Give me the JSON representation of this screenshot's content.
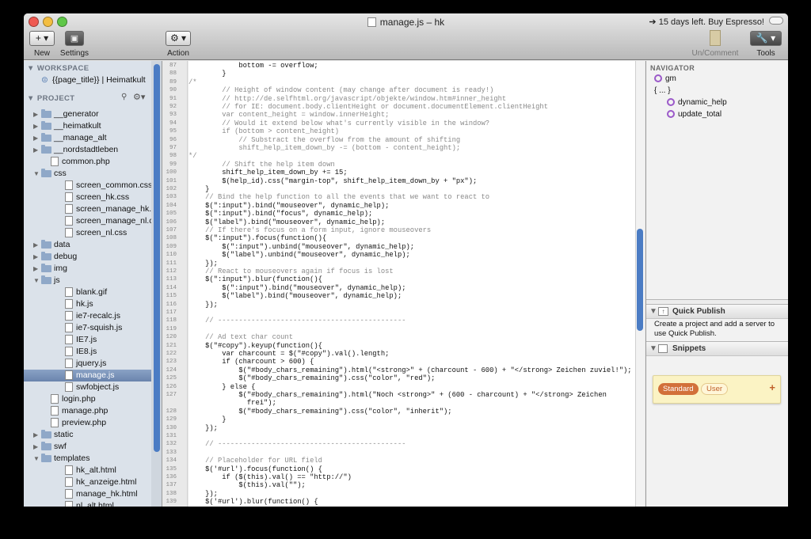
{
  "window": {
    "title": "manage.js – hk",
    "trial_notice": "15 days left. Buy Espresso!"
  },
  "toolbar": {
    "new_label": "New",
    "new_glyph": "+ ▾",
    "settings_label": "Settings",
    "action_label": "Action",
    "action_glyph": "⚙ ▾",
    "uncomment_label": "Un/Comment",
    "tools_label": "Tools",
    "tools_glyph": "🔧 ▾"
  },
  "sidebar": {
    "workspace_header": "WORKSPACE",
    "workspace_item": "{{page_title}} | Heimatkult",
    "project_header": "PROJECT",
    "tree": [
      {
        "label": "__generator",
        "type": "folder",
        "depth": 0,
        "open": false
      },
      {
        "label": "__heimatkult",
        "type": "folder",
        "depth": 0,
        "open": false
      },
      {
        "label": "__manage_alt",
        "type": "folder",
        "depth": 0,
        "open": false
      },
      {
        "label": "__nordstadtleben",
        "type": "folder",
        "depth": 0,
        "open": false
      },
      {
        "label": "common.php",
        "type": "file",
        "depth": 0
      },
      {
        "label": "css",
        "type": "folder",
        "depth": 0,
        "open": true
      },
      {
        "label": "screen_common.css",
        "type": "file",
        "depth": 1
      },
      {
        "label": "screen_hk.css",
        "type": "file",
        "depth": 1
      },
      {
        "label": "screen_manage_hk.css",
        "type": "file",
        "depth": 1
      },
      {
        "label": "screen_manage_nl.css",
        "type": "file",
        "depth": 1
      },
      {
        "label": "screen_nl.css",
        "type": "file",
        "depth": 1
      },
      {
        "label": "data",
        "type": "folder",
        "depth": 0,
        "open": false
      },
      {
        "label": "debug",
        "type": "folder",
        "depth": 0,
        "open": false
      },
      {
        "label": "img",
        "type": "folder",
        "depth": 0,
        "open": false
      },
      {
        "label": "js",
        "type": "folder",
        "depth": 0,
        "open": true
      },
      {
        "label": "blank.gif",
        "type": "file",
        "depth": 1
      },
      {
        "label": "hk.js",
        "type": "file",
        "depth": 1
      },
      {
        "label": "ie7-recalc.js",
        "type": "file",
        "depth": 1
      },
      {
        "label": "ie7-squish.js",
        "type": "file",
        "depth": 1
      },
      {
        "label": "IE7.js",
        "type": "file",
        "depth": 1
      },
      {
        "label": "IE8.js",
        "type": "file",
        "depth": 1
      },
      {
        "label": "jquery.js",
        "type": "file",
        "depth": 1
      },
      {
        "label": "manage.js",
        "type": "file",
        "depth": 1,
        "selected": true
      },
      {
        "label": "swfobject.js",
        "type": "file",
        "depth": 1
      },
      {
        "label": "login.php",
        "type": "file",
        "depth": 0
      },
      {
        "label": "manage.php",
        "type": "file",
        "depth": 0
      },
      {
        "label": "preview.php",
        "type": "file",
        "depth": 0
      },
      {
        "label": "static",
        "type": "folder",
        "depth": 0,
        "open": false
      },
      {
        "label": "swf",
        "type": "folder",
        "depth": 0,
        "open": false
      },
      {
        "label": "templates",
        "type": "folder",
        "depth": 0,
        "open": true
      },
      {
        "label": "hk_alt.html",
        "type": "file",
        "depth": 1
      },
      {
        "label": "hk_anzeige.html",
        "type": "file",
        "depth": 1
      },
      {
        "label": "manage_hk.html",
        "type": "file",
        "depth": 1
      },
      {
        "label": "nl_alt.html",
        "type": "file",
        "depth": 1
      }
    ]
  },
  "editor": {
    "lines": [
      {
        "n": "87",
        "t": "            bottom -= overflow;",
        "c": ""
      },
      {
        "n": "88",
        "t": "        }",
        "c": ""
      },
      {
        "n": "89",
        "t": "/*",
        "c": "cm"
      },
      {
        "n": "90",
        "t": "        // Height of window content (may change after document is ready!)",
        "c": "cm"
      },
      {
        "n": "91",
        "t": "        // http://de.selfhtml.org/javascript/objekte/window.htm#inner_height",
        "c": "cm"
      },
      {
        "n": "92",
        "t": "        // for IE: document.body.clientHeight or document.documentElement.clientHeight",
        "c": "cm"
      },
      {
        "n": "93",
        "t": "        var content_height = window.innerHeight;",
        "c": "cm"
      },
      {
        "n": "94",
        "t": "        // Would it extend below what's currently visible in the window?",
        "c": "cm"
      },
      {
        "n": "95",
        "t": "        if (bottom > content_height)",
        "c": "cm"
      },
      {
        "n": "96",
        "t": "            // Substract the overflow from the amount of shifting",
        "c": "cm"
      },
      {
        "n": "97",
        "t": "            shift_help_item_down_by -= (bottom - content_height);",
        "c": "cm"
      },
      {
        "n": "98",
        "t": "*/",
        "c": "cm"
      },
      {
        "n": "99",
        "t": "        // Shift the help item down",
        "c": "cm"
      },
      {
        "n": "100",
        "t": "        shift_help_item_down_by += 15;",
        "c": ""
      },
      {
        "n": "101",
        "t": "        $(help_id).css(\"margin-top\", shift_help_item_down_by + \"px\");",
        "c": ""
      },
      {
        "n": "102",
        "t": "    }",
        "c": ""
      },
      {
        "n": "103",
        "t": "    // Bind the help function to all the events that we want to react to",
        "c": "cm"
      },
      {
        "n": "104",
        "t": "    $(\":input\").bind(\"mouseover\", dynamic_help);",
        "c": ""
      },
      {
        "n": "105",
        "t": "    $(\":input\").bind(\"focus\", dynamic_help);",
        "c": ""
      },
      {
        "n": "106",
        "t": "    $(\"label\").bind(\"mouseover\", dynamic_help);",
        "c": ""
      },
      {
        "n": "107",
        "t": "    // If there's focus on a form input, ignore mouseovers",
        "c": "cm"
      },
      {
        "n": "108",
        "t": "    $(\":input\").focus(function(){",
        "c": ""
      },
      {
        "n": "109",
        "t": "        $(\":input\").unbind(\"mouseover\", dynamic_help);",
        "c": ""
      },
      {
        "n": "110",
        "t": "        $(\"label\").unbind(\"mouseover\", dynamic_help);",
        "c": ""
      },
      {
        "n": "111",
        "t": "    });",
        "c": ""
      },
      {
        "n": "112",
        "t": "    // React to mouseovers again if focus is lost",
        "c": "cm"
      },
      {
        "n": "113",
        "t": "    $(\":input\").blur(function(){",
        "c": ""
      },
      {
        "n": "114",
        "t": "        $(\":input\").bind(\"mouseover\", dynamic_help);",
        "c": ""
      },
      {
        "n": "115",
        "t": "        $(\"label\").bind(\"mouseover\", dynamic_help);",
        "c": ""
      },
      {
        "n": "116",
        "t": "    });",
        "c": ""
      },
      {
        "n": "117",
        "t": "",
        "c": ""
      },
      {
        "n": "118",
        "t": "    // ---------------------------------------------",
        "c": "cm"
      },
      {
        "n": "119",
        "t": "",
        "c": ""
      },
      {
        "n": "120",
        "t": "    // Ad text char count",
        "c": "cm"
      },
      {
        "n": "121",
        "t": "    $(\"#copy\").keyup(function(){",
        "c": ""
      },
      {
        "n": "122",
        "t": "        var charcount = $(\"#copy\").val().length;",
        "c": ""
      },
      {
        "n": "123",
        "t": "        if (charcount > 600) {",
        "c": ""
      },
      {
        "n": "124",
        "t": "            $(\"#body_chars_remaining\").html(\"<strong>\" + (charcount - 600) + \"</strong> Zeichen zuviel!\");",
        "c": ""
      },
      {
        "n": "125",
        "t": "            $(\"#body_chars_remaining\").css(\"color\", \"red\");",
        "c": ""
      },
      {
        "n": "126",
        "t": "        } else {",
        "c": ""
      },
      {
        "n": "127",
        "t": "            $(\"#body_chars_remaining\").html(\"Noch <strong>\" + (600 - charcount) + \"</strong> Zeichen",
        "c": ""
      },
      {
        "n": "",
        "t": "              frei\");",
        "c": ""
      },
      {
        "n": "128",
        "t": "            $(\"#body_chars_remaining\").css(\"color\", \"inherit\");",
        "c": ""
      },
      {
        "n": "129",
        "t": "        }",
        "c": ""
      },
      {
        "n": "130",
        "t": "    });",
        "c": ""
      },
      {
        "n": "131",
        "t": "",
        "c": ""
      },
      {
        "n": "132",
        "t": "    // ---------------------------------------------",
        "c": "cm"
      },
      {
        "n": "133",
        "t": "",
        "c": ""
      },
      {
        "n": "134",
        "t": "    // Placeholder for URL field",
        "c": "cm"
      },
      {
        "n": "135",
        "t": "    $('#url').focus(function() {",
        "c": ""
      },
      {
        "n": "136",
        "t": "        if ($(this).val() == \"http://\")",
        "c": ""
      },
      {
        "n": "137",
        "t": "            $(this).val(\"\");",
        "c": ""
      },
      {
        "n": "138",
        "t": "    });",
        "c": ""
      },
      {
        "n": "139",
        "t": "    $('#url').blur(function() {",
        "c": ""
      }
    ]
  },
  "navigator": {
    "header": "NAVIGATOR",
    "items": [
      {
        "label": "gm",
        "indent": 0,
        "icon": true
      },
      {
        "label": "{ ... }",
        "indent": 0,
        "icon": false
      },
      {
        "label": "dynamic_help",
        "indent": 1,
        "icon": true
      },
      {
        "label": "update_total",
        "indent": 1,
        "icon": true
      }
    ]
  },
  "quick_publish": {
    "title": "Quick Publish",
    "text": "Create a project and add a server to use Quick Publish."
  },
  "snippets": {
    "title": "Snippets",
    "tab_standard": "Standard",
    "tab_user": "User",
    "add": "+"
  },
  "colors": {
    "selection": "#7590b9",
    "scroll_thumb": "#4b7cc4",
    "comment": "#8a8a8a",
    "string": "#b21010",
    "navigator_icon": "#9b59c9",
    "snippet_accent": "#d2703a"
  }
}
